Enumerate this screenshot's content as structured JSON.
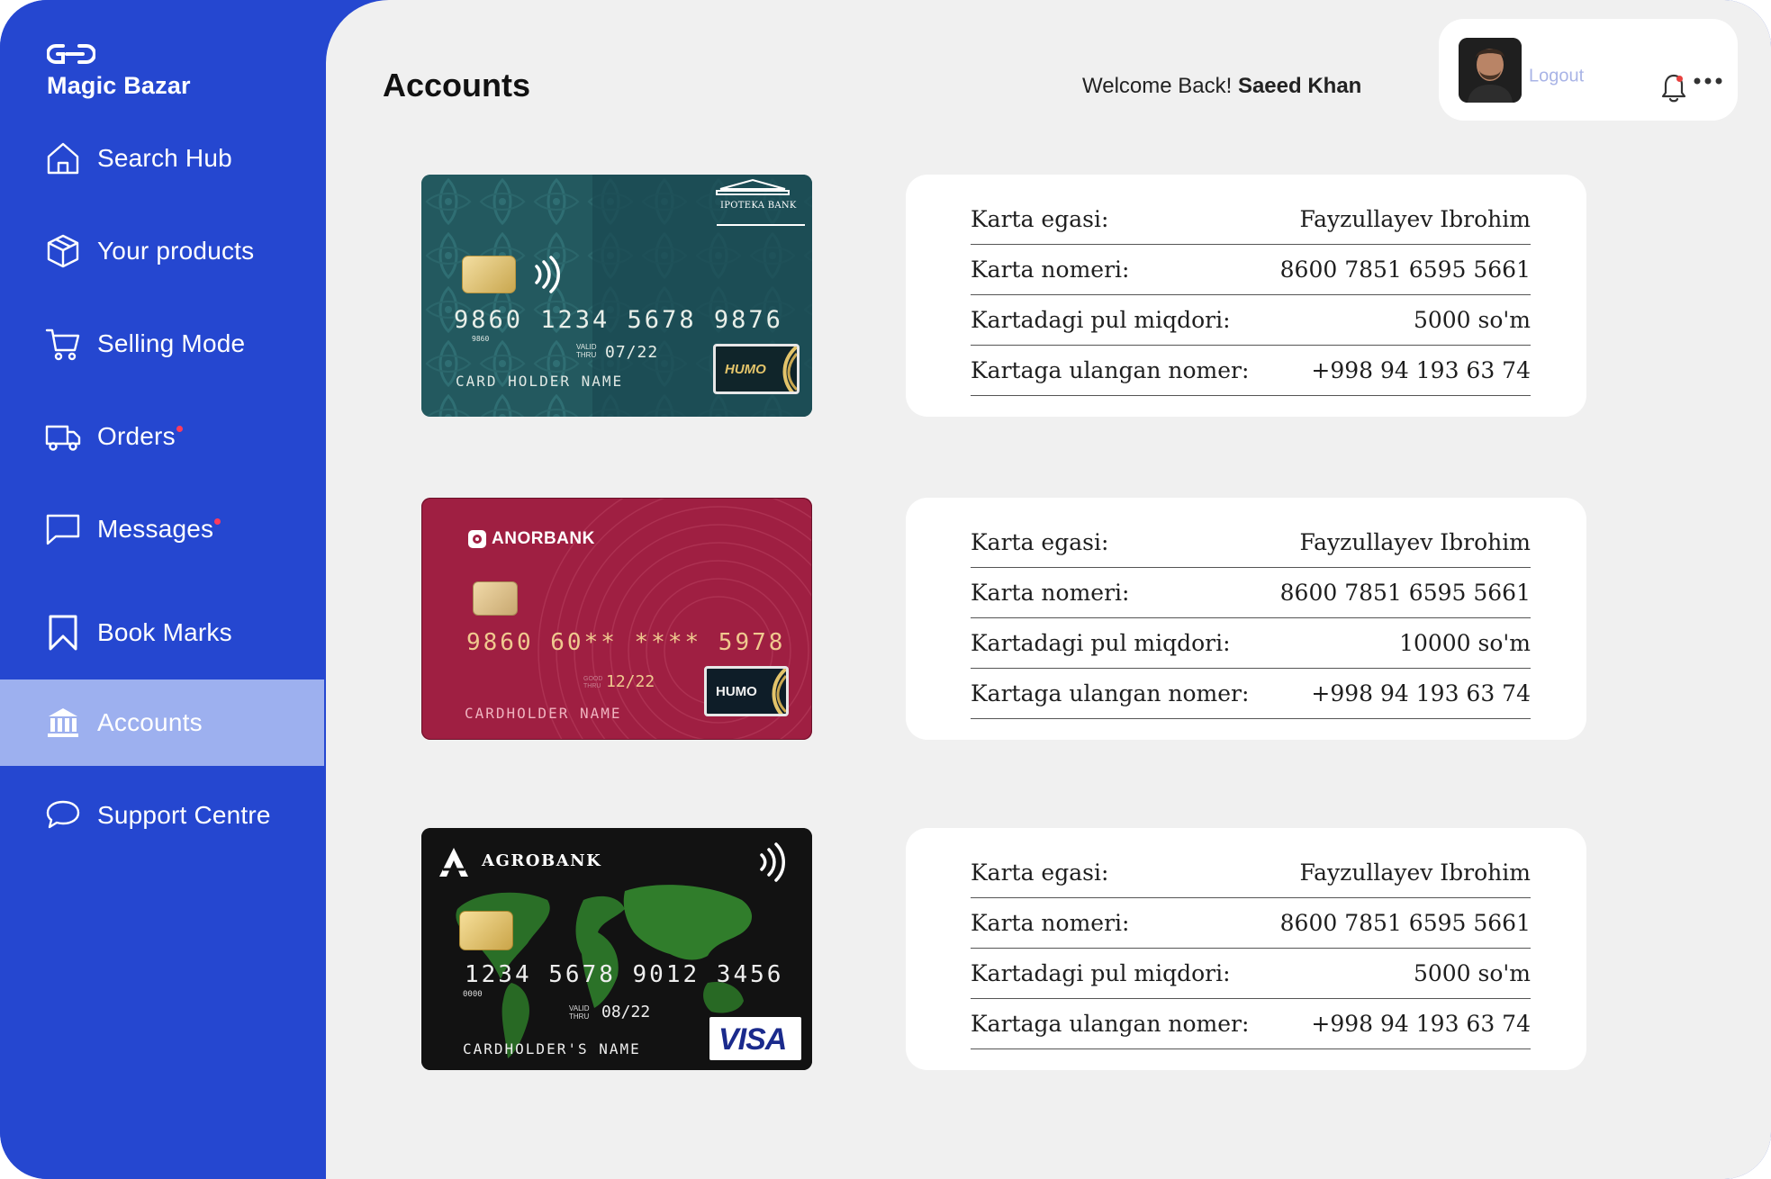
{
  "app": {
    "name": "Magic Bazar"
  },
  "sidebar": {
    "items": [
      {
        "label": "Search Hub",
        "icon": "home-icon",
        "active": false,
        "badge": false
      },
      {
        "label": "Your products",
        "icon": "box-icon",
        "active": false,
        "badge": false
      },
      {
        "label": "Selling Mode",
        "icon": "cart-icon",
        "active": false,
        "badge": false
      },
      {
        "label": "Orders",
        "icon": "truck-icon",
        "active": false,
        "badge": true
      },
      {
        "label": "Messages",
        "icon": "message-icon",
        "active": false,
        "badge": true
      },
      {
        "label": "Book Marks",
        "icon": "bookmark-icon",
        "active": false,
        "badge": false
      },
      {
        "label": "Accounts",
        "icon": "bank-icon",
        "active": true,
        "badge": false
      },
      {
        "label": "Support Centre",
        "icon": "chat-bubble-icon",
        "active": false,
        "badge": false
      }
    ]
  },
  "header": {
    "title": "Accounts",
    "welcome_prefix": "Welcome Back!",
    "user_name": "Saeed Khan",
    "logout_label": "Logout"
  },
  "accounts": [
    {
      "card": {
        "bank": "IPOTEKA BANK",
        "number": "9860 1234 5678 9876",
        "small_number": "9860",
        "valid_label": "VALID THRU",
        "expiry": "07/22",
        "holder": "CARD HOLDER NAME",
        "network": "HUMO"
      },
      "rows": [
        {
          "label": "Karta egasi:",
          "value": "Fayzullayev Ibrohim"
        },
        {
          "label": "Karta nomeri:",
          "value": "8600 7851 6595 5661"
        },
        {
          "label": "Kartadagi pul miqdori:",
          "value": "5000 so'm"
        },
        {
          "label": "Kartaga ulangan nomer:",
          "value": "+998 94 193 63 74"
        }
      ]
    },
    {
      "card": {
        "bank": "ANORBANK",
        "number": "9860 60** **** 5978",
        "valid_label": "GOOD THRU",
        "expiry": "12/22",
        "holder": "CARDHOLDER NAME",
        "network": "HUMO"
      },
      "rows": [
        {
          "label": "Karta egasi:",
          "value": "Fayzullayev Ibrohim"
        },
        {
          "label": "Karta nomeri:",
          "value": "8600 7851 6595 5661"
        },
        {
          "label": "Kartadagi pul miqdori:",
          "value": "10000 so'm"
        },
        {
          "label": "Kartaga ulangan nomer:",
          "value": "+998 94 193 63 74"
        }
      ]
    },
    {
      "card": {
        "bank": "AGROBANK",
        "number": "1234 5678 9012 3456",
        "small_number": "0000",
        "valid_label": "VALID THRU",
        "expiry": "08/22",
        "holder": "CARDHOLDER'S NAME",
        "network": "VISA"
      },
      "rows": [
        {
          "label": "Karta egasi:",
          "value": "Fayzullayev Ibrohim"
        },
        {
          "label": "Karta nomeri:",
          "value": "8600 7851 6595 5661"
        },
        {
          "label": "Kartadagi pul miqdori:",
          "value": "5000 so'm"
        },
        {
          "label": "Kartaga ulangan nomer:",
          "value": "+998 94 193 63 74"
        }
      ]
    }
  ],
  "colors": {
    "sidebar": "#2547d0",
    "sidebar_active": "#9db0ef",
    "main_bg": "#f0f0f0",
    "badge": "#ff3b5c",
    "logout": "#a9b4e6"
  }
}
